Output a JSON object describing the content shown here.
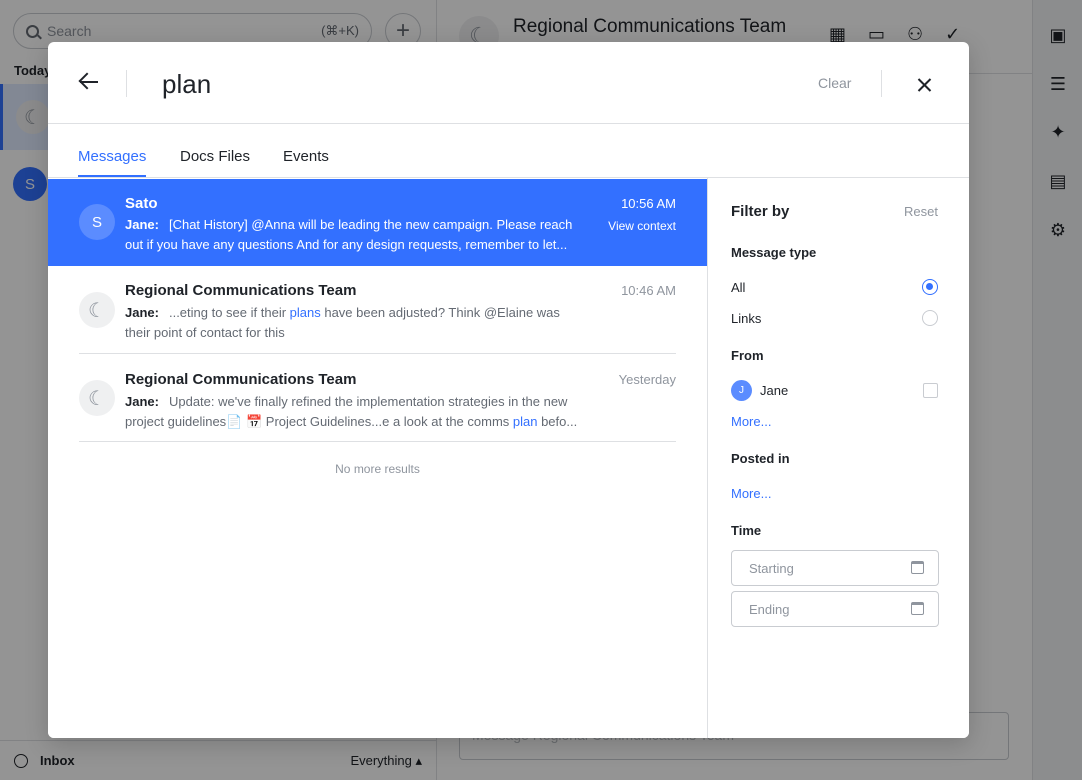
{
  "background": {
    "search": {
      "placeholder": "Search",
      "shortcut": "(⌘+K)"
    },
    "today_label": "Today",
    "second_avatar_letter": "S",
    "inbox_label": "Inbox",
    "filter_label": "Everything ▴",
    "chat_title": "Regional Communications Team",
    "composer_placeholder": "Message Regional Communications Team"
  },
  "modal": {
    "query": "plan",
    "clear_label": "Clear",
    "tabs": [
      {
        "label": "Messages",
        "active": true
      },
      {
        "label": "Docs Files",
        "active": false
      },
      {
        "label": "Events",
        "active": false
      }
    ],
    "results": [
      {
        "name": "Sato",
        "avatar_letter": "S",
        "time": "10:56 AM",
        "action": "View context",
        "sender": "Jane:",
        "line1": "[Chat History] @Anna will be leading the new campaign. Please reach",
        "line2": "out if you have any questions And for any design requests, remember to let..."
      },
      {
        "name": "Regional Communications Team",
        "time": "10:46 AM",
        "sender": "Jane:",
        "line1_pre": "...eting to see if their ",
        "line1_hl": "plans",
        "line1_post": " have been adjusted? Think @Elaine was",
        "line2": "their point of contact for this"
      },
      {
        "name": "Regional Communications Team",
        "time": "Yesterday",
        "sender": "Jane:",
        "line1": "Update: we've finally refined the implementation strategies in the new",
        "line2_pre": "project guidelines📄 📅 Project Guidelines...e a look at the comms ",
        "line2_hl": "plan",
        "line2_post": " befo..."
      }
    ],
    "no_more": "No more results",
    "filter": {
      "title": "Filter by",
      "reset": "Reset",
      "message_type_label": "Message type",
      "type_options": [
        {
          "label": "All",
          "selected": true
        },
        {
          "label": "Links",
          "selected": false
        }
      ],
      "from_label": "From",
      "from_person": {
        "initial": "J",
        "name": "Jane",
        "checked": false
      },
      "more_label": "More...",
      "posted_in_label": "Posted in",
      "posted_more_label": "More...",
      "time_label": "Time",
      "starting_placeholder": "Starting",
      "ending_placeholder": "Ending"
    }
  },
  "colors": {
    "accent": "#3370ff",
    "overlay": "rgba(0,0,0,0.42)"
  }
}
